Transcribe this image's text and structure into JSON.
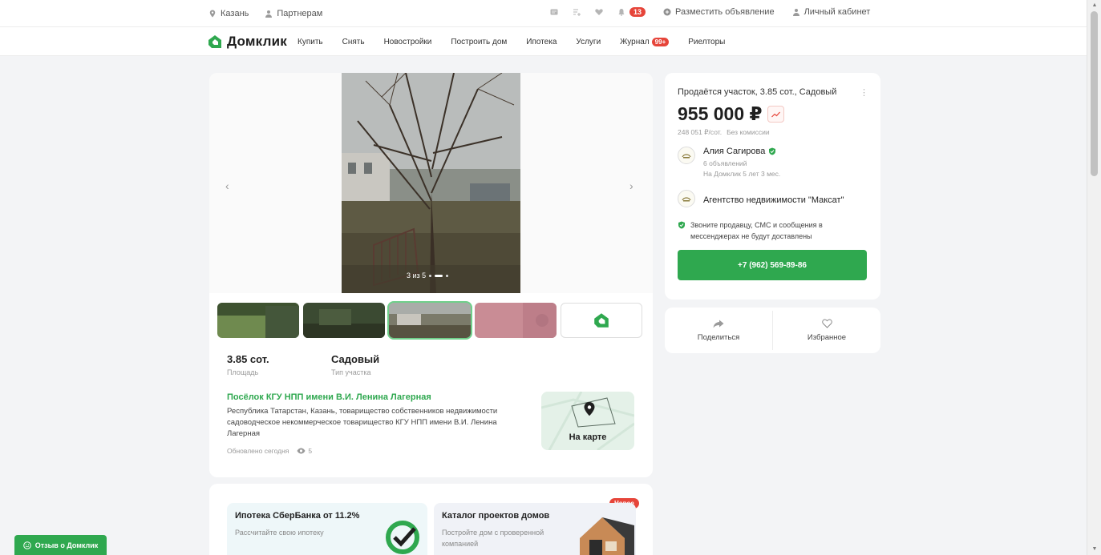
{
  "topbar": {
    "city": "Казань",
    "partners": "Партнерам",
    "notifications_count": "13",
    "post_ad": "Разместить объявление",
    "account": "Личный кабинет"
  },
  "nav": {
    "logo": "Домклик",
    "items": [
      "Купить",
      "Снять",
      "Новостройки",
      "Построить дом",
      "Ипотека",
      "Услуги",
      "Журнал",
      "Риелторы"
    ],
    "journal_badge": "99+"
  },
  "gallery": {
    "counter": "3 из 5"
  },
  "features": [
    {
      "value": "3.85 сот.",
      "label": "Площадь"
    },
    {
      "value": "Садовый",
      "label": "Тип участка"
    }
  ],
  "address": {
    "title": "Посёлок КГУ НПП имени В.И. Ленина Лагерная",
    "text": "Республика Татарстан, Казань, товарищество собственников недвижимости садоводческое некоммерческое товарищество КГУ НПП имени В.И. Ленина Лагерная",
    "updated": "Обновлено сегодня",
    "views": "5",
    "map_label": "На карте"
  },
  "promo": {
    "mortgage_title": "Ипотека СберБанка от 11.2%",
    "mortgage_sub": "Рассчитайте свою ипотеку",
    "catalog_title": "Каталог проектов домов",
    "catalog_sub": "Постройте дом с проверенной компанией",
    "new_badge": "Новое"
  },
  "listing": {
    "title": "Продаётся участок, 3.85 сот., Садовый",
    "price": "955 000 ₽",
    "price_per": "248 051 ₽/сот.",
    "commission": "Без комиссии",
    "seller_name": "Алия Сагирова",
    "seller_ads": "6 объявлений",
    "seller_since": "На Домклик 5 лет 3 мес.",
    "agency": "Агентство недвижимости \"Максат\"",
    "notice": "Звоните продавцу, СМС и сообщения в мессенджерах не будут доставлены",
    "phone": "+7 (962) 569-89-86"
  },
  "actions": {
    "share": "Поделиться",
    "favorite": "Избранное"
  },
  "feedback": "Отзыв о Домклик",
  "colors": {
    "brand_green": "#2fa84f",
    "accent_red": "#e6453a"
  }
}
